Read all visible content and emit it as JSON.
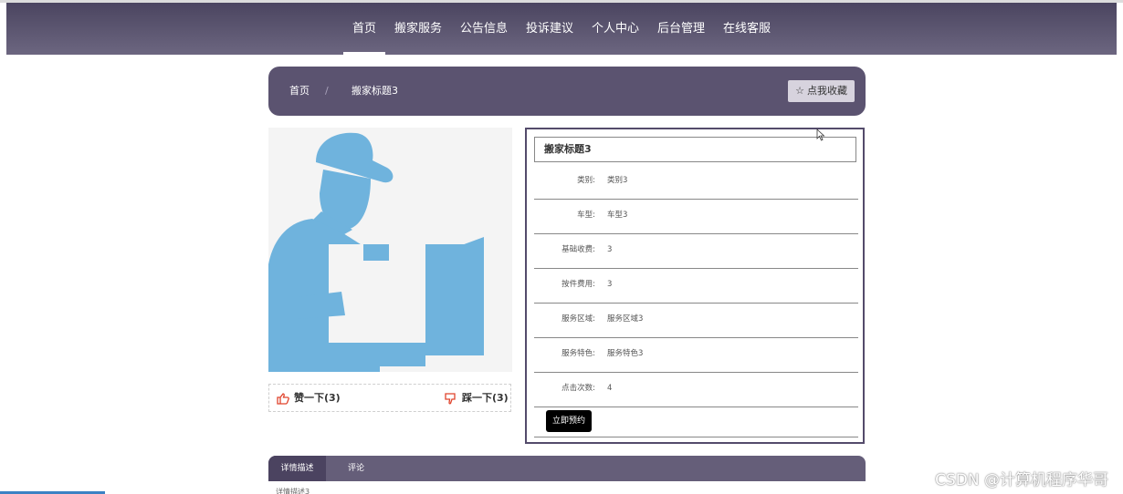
{
  "nav": {
    "items": [
      {
        "label": "首页",
        "active": true
      },
      {
        "label": "搬家服务"
      },
      {
        "label": "公告信息"
      },
      {
        "label": "投诉建议"
      },
      {
        "label": "个人中心"
      },
      {
        "label": "后台管理"
      },
      {
        "label": "在线客服"
      }
    ]
  },
  "breadcrumb": {
    "home": "首页",
    "separator": "/",
    "current": "搬家标题3",
    "favorite_label": "点我收藏"
  },
  "votes": {
    "like_label": "赞一下(3)",
    "dislike_label": "踩一下(3)"
  },
  "detail": {
    "title": "搬家标题3",
    "fields": [
      {
        "label": "类别:",
        "value": "类别3"
      },
      {
        "label": "车型:",
        "value": "车型3"
      },
      {
        "label": "基础收费:",
        "value": "3"
      },
      {
        "label": "按件费用:",
        "value": "3"
      },
      {
        "label": "服务区域:",
        "value": "服务区域3"
      },
      {
        "label": "服务特色:",
        "value": "服务特色3"
      },
      {
        "label": "点击次数:",
        "value": "4"
      }
    ],
    "book_label": "立即预约"
  },
  "tabs": {
    "items": [
      {
        "label": "详情描述"
      },
      {
        "label": "评论"
      }
    ],
    "content_peek": "详情描述3"
  },
  "watermark": "CSDN @计算机程序华哥",
  "colors": {
    "nav_bg": "#5b5370",
    "accent": "#544b6b",
    "figure_blue": "#6fb3dd",
    "like_red": "#e0432c"
  }
}
